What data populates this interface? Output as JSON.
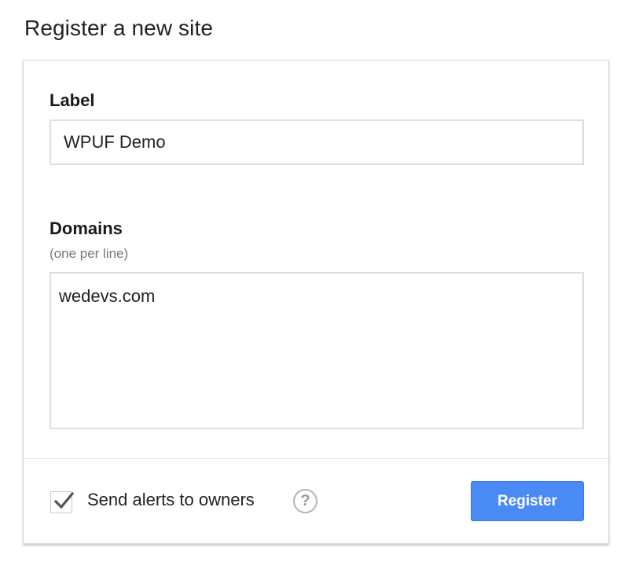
{
  "page": {
    "title": "Register a new site"
  },
  "form": {
    "label": {
      "title": "Label",
      "value": "WPUF Demo"
    },
    "domains": {
      "title": "Domains",
      "hint": "(one per line)",
      "value": "wedevs.com"
    },
    "alerts": {
      "label": "Send alerts to owners",
      "checked": true,
      "help_icon": "question-circle-icon",
      "help_glyph": "?"
    },
    "register_button": {
      "label": "Register"
    }
  },
  "colors": {
    "accent": "#4a8af4",
    "accent_border": "#3b78e7",
    "muted_text": "#777777"
  }
}
